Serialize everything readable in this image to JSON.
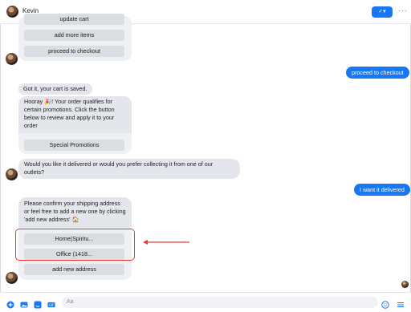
{
  "header": {
    "name": "Kevin",
    "action_label": "✓▾",
    "more": "···"
  },
  "messages": {
    "cart_card": {
      "options": [
        "update cart",
        "add more items",
        "proceed to checkout"
      ]
    },
    "out_checkout": "proceed to checkout",
    "cart_saved": "Got it, your cart is saved.",
    "promo_text": "Hooray 🎉! Your order qualifies for certain promotions. Click the button below to review and apply it to your order",
    "promo_button": "Special Promotions",
    "delivery_question": "Would you like it delivered or would you prefer collecting it from one of our outlets?",
    "out_delivered": "I want it delivered",
    "address_text": "Please confirm your shipping address or feel free to add a new one by clicking 'add new address' 🏠",
    "address_options": [
      "Home(Spiritu...",
      "Office (1418...",
      "add new address"
    ]
  },
  "composer": {
    "placeholder": "Aa"
  },
  "colors": {
    "accent": "#1877f2",
    "highlight": "#e53935"
  }
}
